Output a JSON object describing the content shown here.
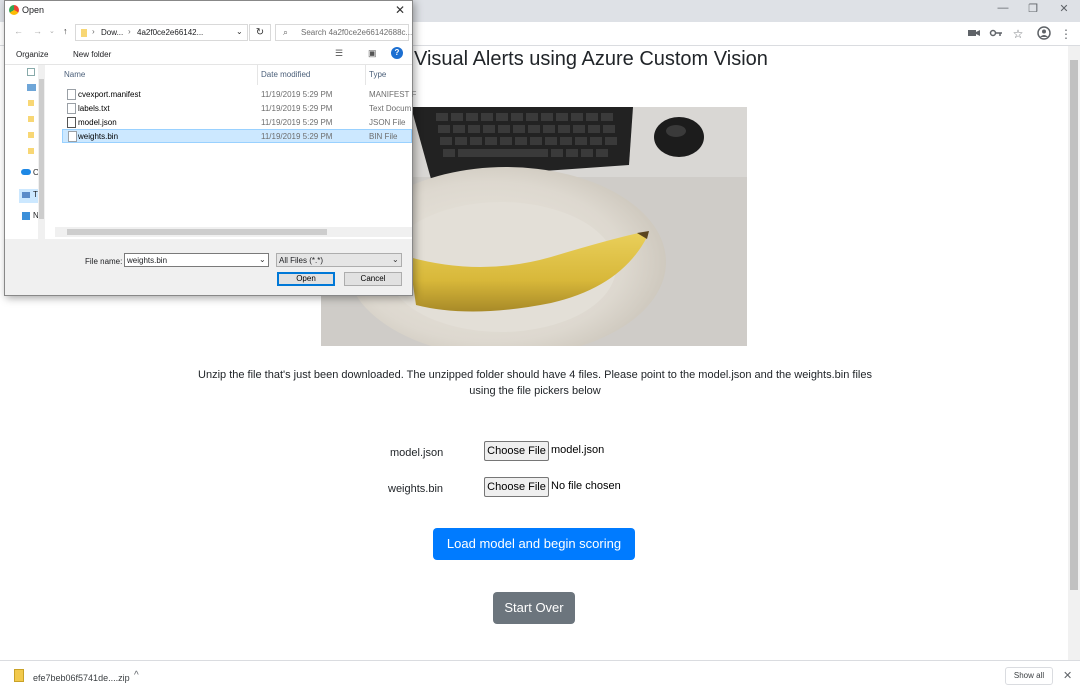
{
  "browser": {
    "window_controls": {
      "minimize": "—",
      "restore": "❐",
      "close": "✕"
    },
    "toolbar_icons": [
      "camera-icon",
      "key-icon",
      "star-icon",
      "account-icon",
      "menu-icon"
    ]
  },
  "page": {
    "heading": "Visual Alerts using Azure Custom Vision",
    "instructions": "Unzip the file that's just been downloaded. The unzipped folder should have 4 files. Please point to the model.json and the weights.bin files using the file pickers below",
    "model_label": "model.json",
    "model_button": "Choose File",
    "model_status": "model.json",
    "weights_label": "weights.bin",
    "weights_button": "Choose File",
    "weights_status": "No file chosen",
    "load_button": "Load model and begin scoring",
    "start_over_button": "Start Over",
    "colors": {
      "primary": "#007bff",
      "secondary": "#6c757d"
    }
  },
  "download_bar": {
    "file": "efe7beb06f5741de....zip",
    "show_all": "Show all"
  },
  "dialog": {
    "title": "Open",
    "breadcrumb_1": "Dow...",
    "breadcrumb_2": "4a2f0ce2e66142...",
    "search_placeholder": "Search 4a2f0ce2e66142688c...",
    "organize": "Organize",
    "new_folder": "New folder",
    "columns": {
      "name": "Name",
      "date": "Date modified",
      "type": "Type"
    },
    "files": [
      {
        "name": "cvexport.manifest",
        "date": "11/19/2019 5:29 PM",
        "type": "MANIFEST F"
      },
      {
        "name": "labels.txt",
        "date": "11/19/2019 5:29 PM",
        "type": "Text Docum"
      },
      {
        "name": "model.json",
        "date": "11/19/2019 5:29 PM",
        "type": "JSON File"
      },
      {
        "name": "weights.bin",
        "date": "11/19/2019 5:29 PM",
        "type": "BIN File"
      }
    ],
    "nav_labels": [
      "O",
      "Tl",
      "N"
    ],
    "file_name_label": "File name:",
    "file_name_value": "weights.bin",
    "filter": "All Files (*.*)",
    "open_button": "Open",
    "cancel_button": "Cancel"
  }
}
